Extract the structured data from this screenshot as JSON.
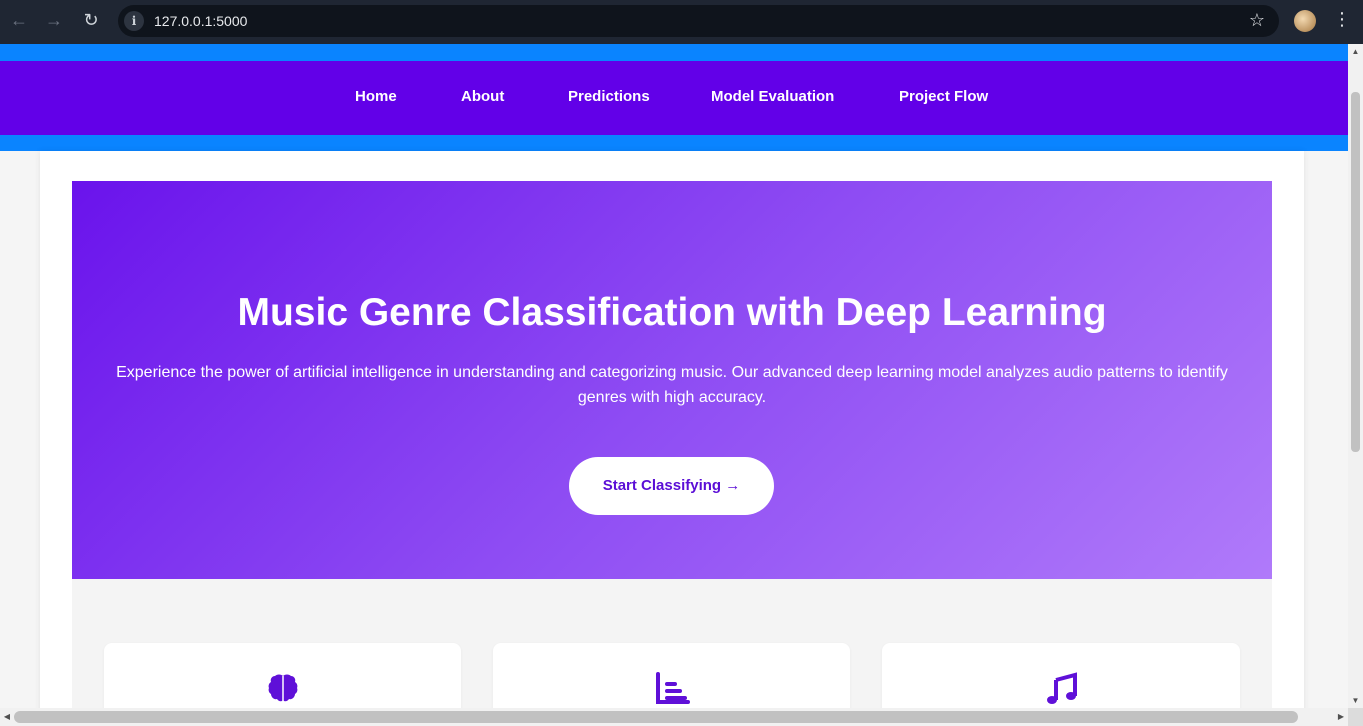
{
  "browser": {
    "url": "127.0.0.1:5000",
    "back_icon": "arrow-left-icon",
    "forward_icon": "arrow-right-icon",
    "reload_icon": "reload-icon",
    "info_icon": "info-icon",
    "star_icon": "star-icon",
    "menu_icon": "kebab-menu-icon"
  },
  "nav": {
    "items": [
      {
        "label": "Home"
      },
      {
        "label": "About"
      },
      {
        "label": "Predictions"
      },
      {
        "label": "Model Evaluation"
      },
      {
        "label": "Project Flow"
      }
    ]
  },
  "hero": {
    "title": "Music Genre Classification with Deep Learning",
    "description": "Experience the power of artificial intelligence in understanding and categorizing music. Our advanced deep learning model analyzes audio patterns to identify genres with high accuracy.",
    "cta_label": "Start Classifying →"
  },
  "features": [
    {
      "icon": "brain-icon"
    },
    {
      "icon": "bar-chart-icon"
    },
    {
      "icon": "music-note-icon"
    }
  ],
  "colors": {
    "navbar": "#6200e8",
    "band": "#0a84ff",
    "hero_start": "#6a13ec",
    "hero_end": "#b07afa",
    "accent": "#5b0ed6"
  }
}
